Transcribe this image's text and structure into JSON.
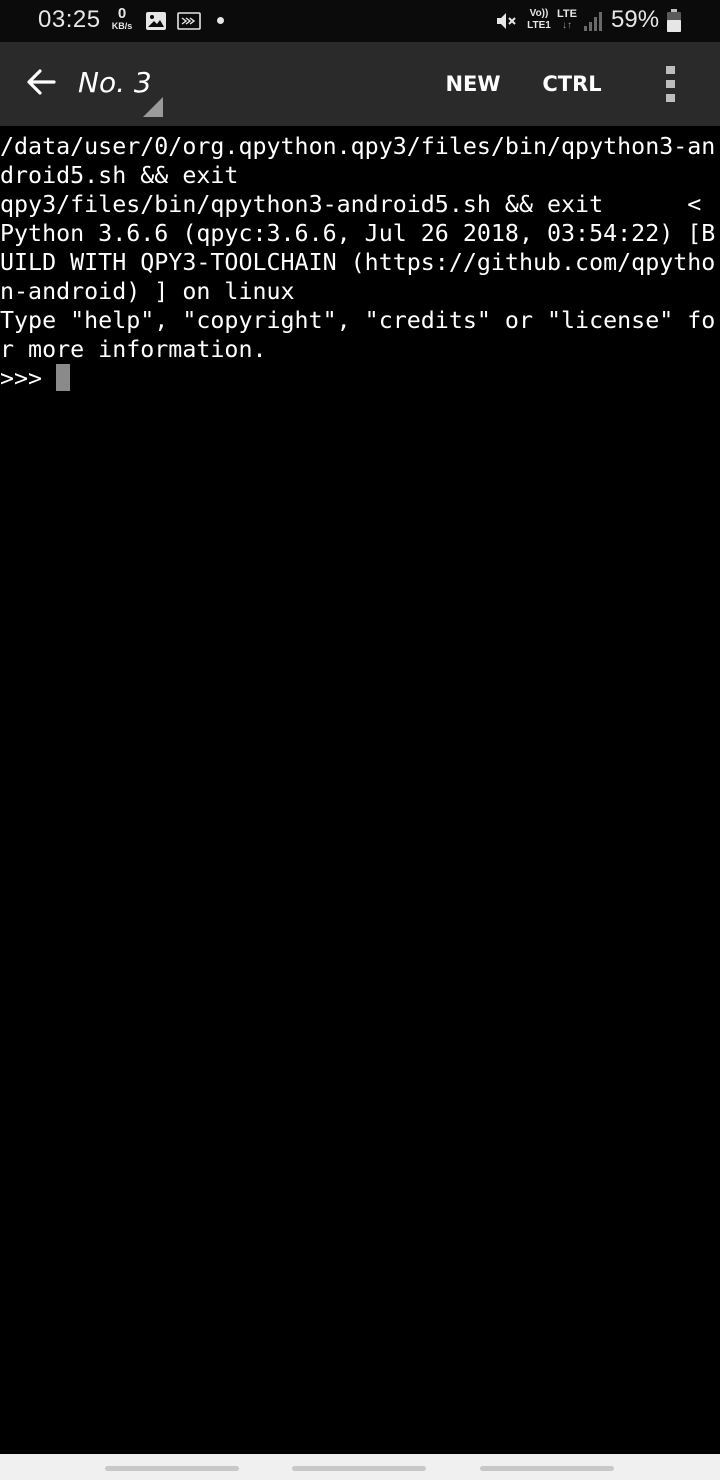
{
  "status_bar": {
    "time": "03:25",
    "net_speed_value": "0",
    "net_speed_unit": "KB/s",
    "volte_top": "Vo))",
    "volte_bottom": "LTE1",
    "network_type": "LTE",
    "network_arrows": "↓↑",
    "battery_percent": "59%",
    "icons": [
      "gallery-icon",
      "screen-cast-icon",
      "notification-dot",
      "mute-icon",
      "signal-icon",
      "battery-icon"
    ]
  },
  "toolbar": {
    "title": "No. 3",
    "new_label": "NEW",
    "ctrl_label": "CTRL",
    "icons": [
      "back-arrow-icon",
      "dropdown-triangle-icon",
      "overflow-menu-icon"
    ]
  },
  "terminal": {
    "lines": [
      "/data/user/0/org.qpython.qpy3/files/bin/qpython3-an",
      "droid5.sh && exit",
      "qpy3/files/bin/qpython3-android5.sh && exit      <",
      "Python 3.6.6 (qpyc:3.6.6, Jul 26 2018, 03:54:22) [B",
      "UILD WITH QPY3-TOOLCHAIN (https://github.com/qpytho",
      "n-android) ] on linux",
      "Type \"help\", \"copyright\", \"credits\" or \"license\" fo",
      "r more information."
    ],
    "prompt": ">>> "
  },
  "colors": {
    "status_bar_bg": "#0b0b0b",
    "toolbar_bg": "#2a2a2a",
    "terminal_bg": "#000000",
    "terminal_fg": "#ffffff",
    "cursor": "#8a8a8a",
    "nav_bar_bg": "#f0f0f0"
  }
}
